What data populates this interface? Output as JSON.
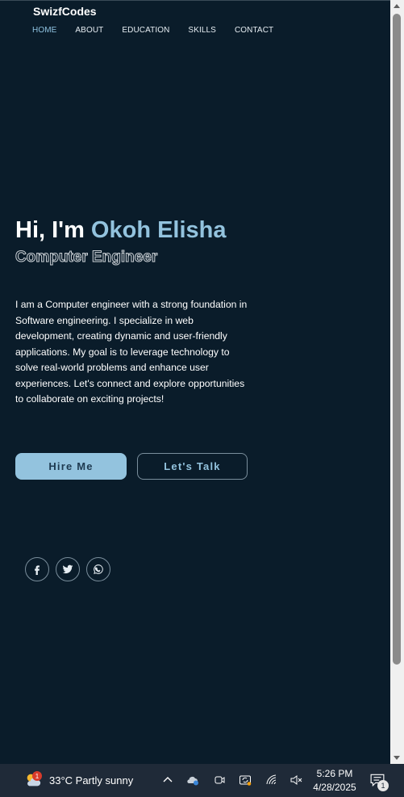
{
  "header": {
    "brand": "SwizfCodes",
    "nav": [
      "HOME",
      "ABOUT",
      "EDUCATION",
      "SKILLS",
      "CONTACT"
    ],
    "active": "HOME"
  },
  "hero": {
    "greeting": "Hi, I'm ",
    "name": "Okoh Elisha",
    "role": "Computer Engineer",
    "bio": "I am a Computer engineer with a strong foundation in Software engineering. I specialize in web development, creating dynamic and user-friendly applications. My goal is to leverage technology to solve real-world problems and enhance user experiences. Let's connect and explore opportunities to collaborate on exciting projects!",
    "primary_button": "Hire Me",
    "secondary_button": "Let's Talk"
  },
  "socials": [
    "facebook-icon",
    "twitter-icon",
    "whatsapp-icon"
  ],
  "colors": {
    "background": "#0a1c2a",
    "accent": "#93c3de"
  },
  "taskbar": {
    "weather_badge": "1",
    "weather": "33°C  Partly sunny",
    "time": "5:26 PM",
    "date": "4/28/2025",
    "notification_count": "1"
  }
}
